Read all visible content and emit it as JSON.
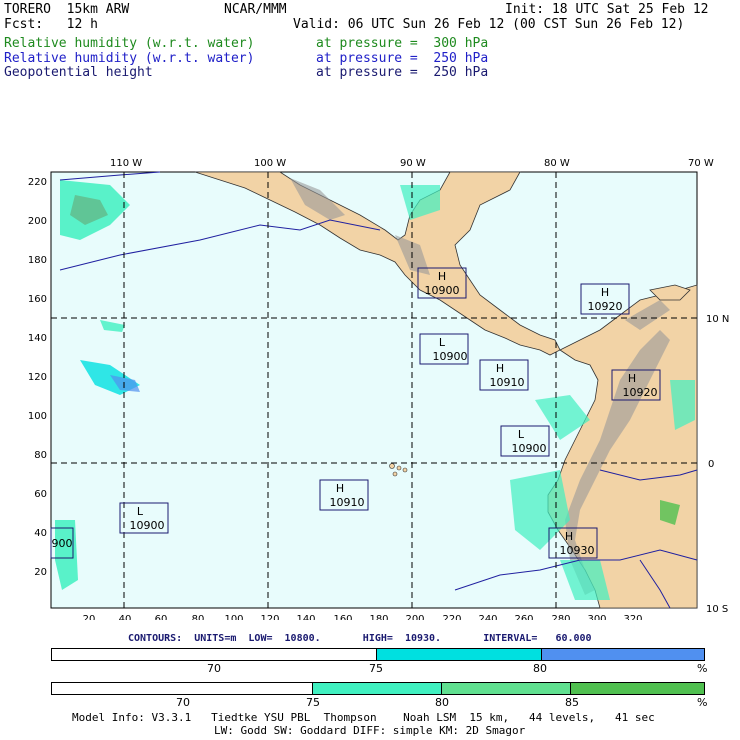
{
  "header": {
    "model": "TORERO  15km ARW",
    "center": "NCAR/MMM",
    "init": "Init: 18 UTC Sat 25 Feb 12",
    "fcst": "Fcst:   12 h",
    "valid": "Valid: 06 UTC Sun 26 Feb 12 (00 CST Sun 26 Feb 12)",
    "fields": [
      {
        "name": "Relative humidity (w.r.t. water)",
        "level": "at pressure =  300 hPa",
        "color": "#1e8a1e"
      },
      {
        "name": "Relative humidity (w.r.t. water)",
        "level": "at pressure =  250 hPa",
        "color": "#2020c8"
      },
      {
        "name": "Geopotential height",
        "level": "at pressure =  250 hPa",
        "color": "#1a1a70"
      }
    ]
  },
  "map": {
    "lon_labels": [
      "110 W",
      "100 W",
      "90 W",
      "80 W",
      "70 W"
    ],
    "lat_labels": [
      "10 N",
      "0",
      "10 S"
    ],
    "y_ticks": [
      "220",
      "200",
      "180",
      "160",
      "140",
      "120",
      "100",
      "80",
      "60",
      "40",
      "20"
    ],
    "x_ticks": [
      "20",
      "40",
      "60",
      "80",
      "100",
      "120",
      "140",
      "160",
      "180",
      "200",
      "220",
      "240",
      "260",
      "280",
      "300",
      "320"
    ],
    "centers": [
      {
        "type": "H",
        "value": "10900"
      },
      {
        "type": "H",
        "value": "10920"
      },
      {
        "type": "L",
        "value": "10900"
      },
      {
        "type": "H",
        "value": "10910"
      },
      {
        "type": "H",
        "value": "10920"
      },
      {
        "type": "L",
        "value": "10900"
      },
      {
        "type": "H",
        "value": "10910"
      },
      {
        "type": "L",
        "value": "10900"
      },
      {
        "type": "H",
        "value": "10930"
      },
      {
        "type": "",
        "value": "900"
      }
    ]
  },
  "contours": {
    "text": "CONTOURS:  UNITS=m  LOW=  10800.       HIGH=  10930.       INTERVAL=   60.000"
  },
  "colorbar1": {
    "labels": [
      "70",
      "75",
      "80",
      "%"
    ],
    "colors": [
      "#ffffff",
      "#00e0e0",
      "#5090f0"
    ]
  },
  "colorbar2": {
    "labels": [
      "70",
      "75",
      "80",
      "85",
      "%"
    ],
    "colors": [
      "#ffffff",
      "#40f0c0",
      "#60e090",
      "#50c050"
    ]
  },
  "footer": {
    "line1": "Model Info: V3.3.1   Tiedtke YSU PBL  Thompson    Noah LSM  15 km,   44 levels,   41 sec",
    "line2": "LW: Godd SW: Goddard DIFF: simple KM: 2D Smagor"
  }
}
